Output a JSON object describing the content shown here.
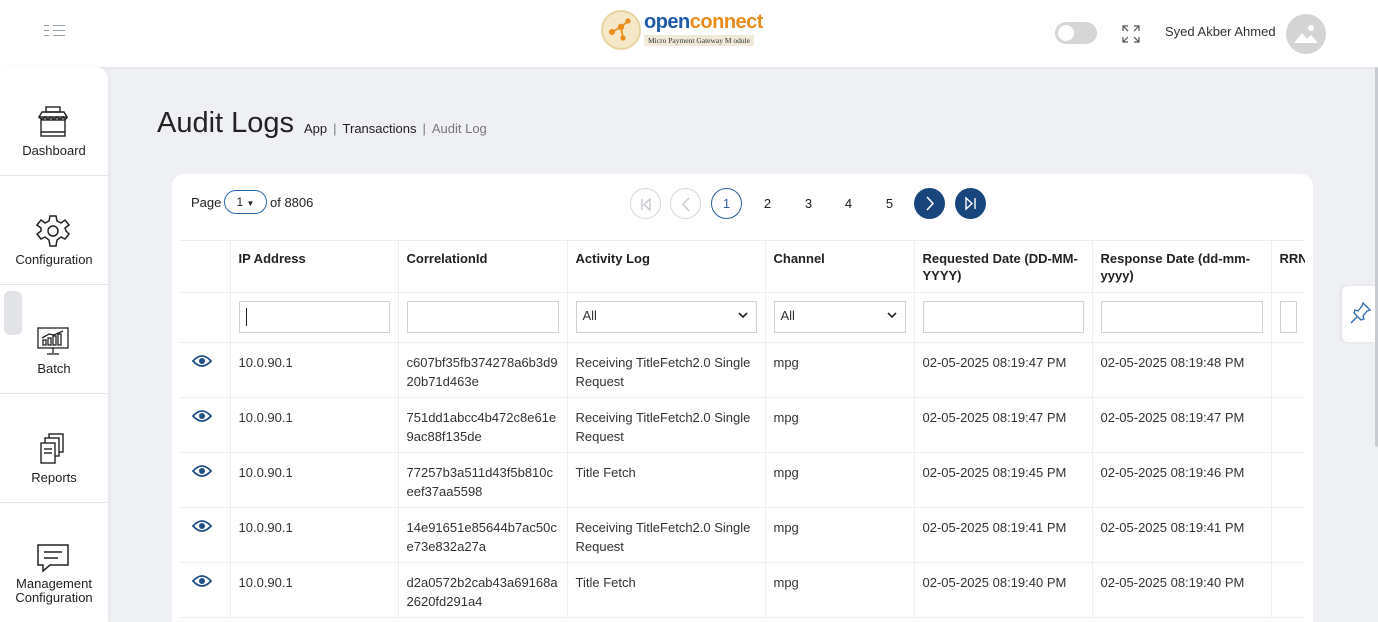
{
  "header": {
    "logo": {
      "name_part1": "open",
      "name_part2": "connect",
      "tagline": "Micro Payment  Gateway M odule"
    },
    "user_name": "Syed Akber Ahmed"
  },
  "sidebar": {
    "items": [
      {
        "label": "Dashboard",
        "icon": "storefront-icon"
      },
      {
        "label": "Configuration",
        "icon": "gear-icon"
      },
      {
        "label": "Batch",
        "icon": "chart-monitor-icon"
      },
      {
        "label": "Reports",
        "icon": "documents-icon"
      },
      {
        "label": "Management",
        "label2": "Configuration",
        "icon": "chat-message-icon"
      }
    ]
  },
  "page": {
    "title": "Audit Logs",
    "breadcrumb": [
      "App",
      "Transactions",
      "Audit Log"
    ]
  },
  "pagination": {
    "label": "Page",
    "current": "1",
    "of_label": "of 8806",
    "pages": [
      "1",
      "2",
      "3",
      "4",
      "5"
    ]
  },
  "table": {
    "columns": [
      "IP Address",
      "CorrelationId",
      "Activity Log",
      "Channel",
      "Requested Date (DD-MM-YYYY)",
      "Response Date (dd-mm-yyyy)",
      "RRN"
    ],
    "filters": {
      "activity": "All",
      "channel": "All"
    },
    "rows": [
      {
        "ip": "10.0.90.1",
        "correlation": "c607bf35fb374278a6b3d920b71d463e",
        "activity": "Receiving TitleFetch2.0 Single Request",
        "channel": "mpg",
        "requested": "02-05-2025 08:19:47 PM",
        "response": "02-05-2025 08:19:48 PM"
      },
      {
        "ip": "10.0.90.1",
        "correlation": "751dd1abcc4b472c8e61e9ac88f135de",
        "activity": "Receiving TitleFetch2.0 Single Request",
        "channel": "mpg",
        "requested": "02-05-2025 08:19:47 PM",
        "response": "02-05-2025 08:19:47 PM"
      },
      {
        "ip": "10.0.90.1",
        "correlation": "77257b3a511d43f5b810ceef37aa5598",
        "activity": "Title Fetch",
        "channel": "mpg",
        "requested": "02-05-2025 08:19:45 PM",
        "response": "02-05-2025 08:19:46 PM"
      },
      {
        "ip": "10.0.90.1",
        "correlation": "14e91651e85644b7ac50ce73e832a27a",
        "activity": "Receiving TitleFetch2.0 Single Request",
        "channel": "mpg",
        "requested": "02-05-2025 08:19:41 PM",
        "response": "02-05-2025 08:19:41 PM"
      },
      {
        "ip": "10.0.90.1",
        "correlation": "d2a0572b2cab43a69168a2620fd291a4",
        "activity": "Title Fetch",
        "channel": "mpg",
        "requested": "02-05-2025 08:19:40 PM",
        "response": "02-05-2025 08:19:40 PM"
      }
    ]
  },
  "colors": {
    "primary_dark": "#18457b",
    "accent_blue": "#2a6bb0",
    "logo_orange": "#e98c1c",
    "logo_blue": "#1e5aa8"
  }
}
